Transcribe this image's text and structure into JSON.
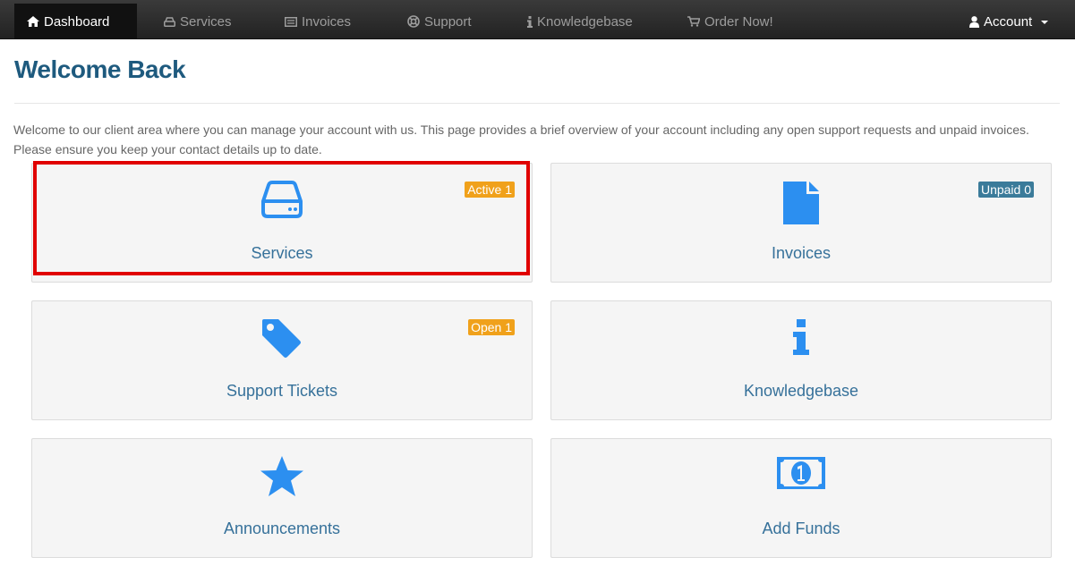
{
  "nav": {
    "dashboard": "Dashboard",
    "services": "Services",
    "invoices": "Invoices",
    "support": "Support",
    "knowledgebase": "Knowledgebase",
    "order": "Order Now!",
    "account": "Account"
  },
  "page": {
    "title": "Welcome Back",
    "intro": "Welcome to our client area where you can manage your account with us. This page provides a brief overview of your account including any open support requests and unpaid invoices. Please ensure you keep your contact details up to date."
  },
  "tiles": {
    "services": {
      "label": "Services",
      "badge": "Active 1"
    },
    "invoices": {
      "label": "Invoices",
      "badge": "Unpaid 0"
    },
    "tickets": {
      "label": "Support Tickets",
      "badge": "Open 1"
    },
    "knowledgebase": {
      "label": "Knowledgebase"
    },
    "announcements": {
      "label": "Announcements"
    },
    "funds": {
      "label": "Add Funds"
    }
  },
  "colors": {
    "icon": "#2c8ff0",
    "badge_orange": "#f0a11b",
    "badge_teal": "#3b7b9a",
    "title": "#1e5a7e",
    "highlight": "#e00000"
  }
}
